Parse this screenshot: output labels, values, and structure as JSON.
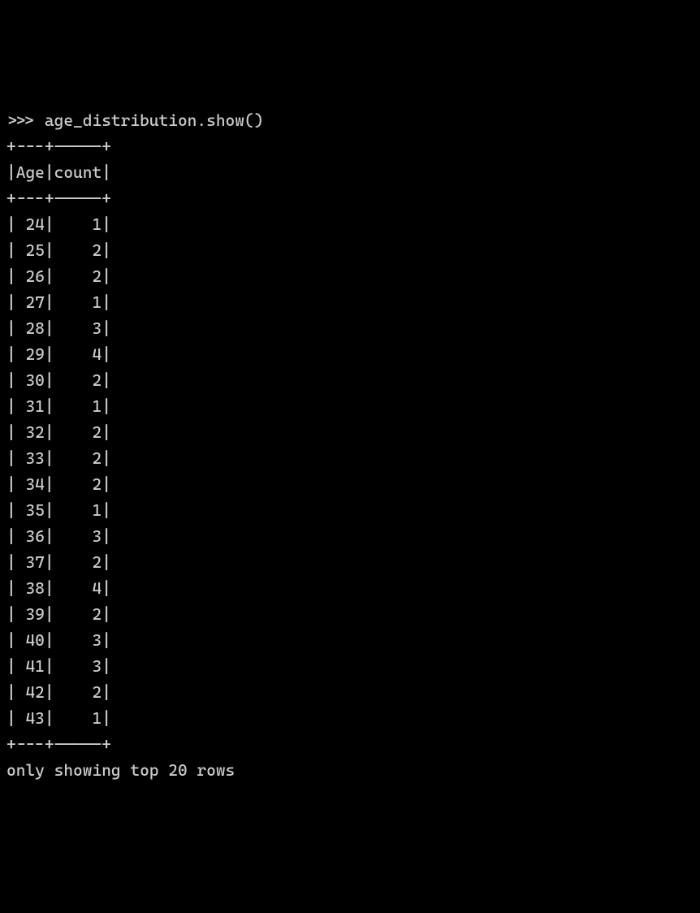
{
  "prompt": ">>> ",
  "command": "age_distribution.show()",
  "table": {
    "separator": "+---+-----+",
    "header_row": "|Age|count|",
    "columns": [
      "Age",
      "count"
    ],
    "rows": [
      {
        "age": 24,
        "count": 1
      },
      {
        "age": 25,
        "count": 2
      },
      {
        "age": 26,
        "count": 2
      },
      {
        "age": 27,
        "count": 1
      },
      {
        "age": 28,
        "count": 3
      },
      {
        "age": 29,
        "count": 4
      },
      {
        "age": 30,
        "count": 2
      },
      {
        "age": 31,
        "count": 1
      },
      {
        "age": 32,
        "count": 2
      },
      {
        "age": 33,
        "count": 2
      },
      {
        "age": 34,
        "count": 2
      },
      {
        "age": 35,
        "count": 1
      },
      {
        "age": 36,
        "count": 3
      },
      {
        "age": 37,
        "count": 2
      },
      {
        "age": 38,
        "count": 4
      },
      {
        "age": 39,
        "count": 2
      },
      {
        "age": 40,
        "count": 3
      },
      {
        "age": 41,
        "count": 3
      },
      {
        "age": 42,
        "count": 2
      },
      {
        "age": 43,
        "count": 1
      }
    ]
  },
  "footer": "only showing top 20 rows",
  "chart_data": {
    "type": "table",
    "columns": [
      "Age",
      "count"
    ],
    "data": [
      [
        24,
        1
      ],
      [
        25,
        2
      ],
      [
        26,
        2
      ],
      [
        27,
        1
      ],
      [
        28,
        3
      ],
      [
        29,
        4
      ],
      [
        30,
        2
      ],
      [
        31,
        1
      ],
      [
        32,
        2
      ],
      [
        33,
        2
      ],
      [
        34,
        2
      ],
      [
        35,
        1
      ],
      [
        36,
        3
      ],
      [
        37,
        2
      ],
      [
        38,
        4
      ],
      [
        39,
        2
      ],
      [
        40,
        3
      ],
      [
        41,
        3
      ],
      [
        42,
        2
      ],
      [
        43,
        1
      ]
    ]
  }
}
